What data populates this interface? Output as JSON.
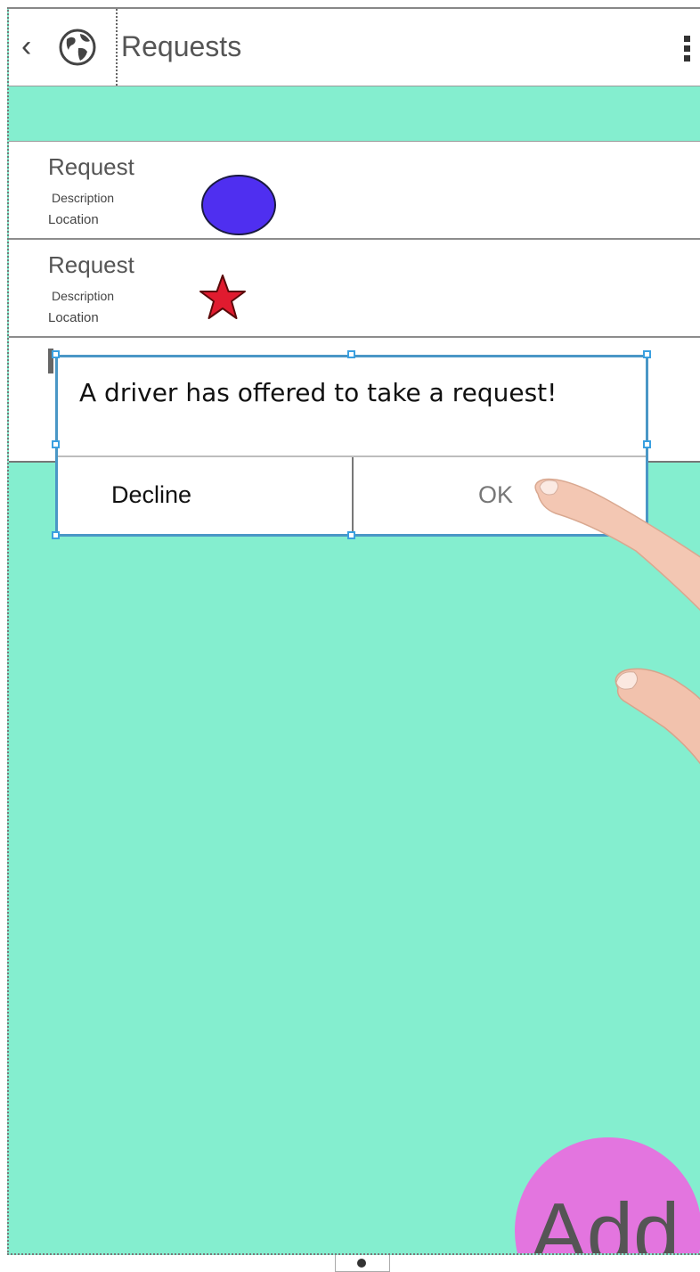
{
  "appbar": {
    "back_icon": "chevron-left-icon",
    "back_glyph": "‹",
    "globe_icon": "globe-icon",
    "title": "Requests",
    "menu_icon": "kebab-menu-icon"
  },
  "requests": [
    {
      "title": "Request",
      "description": "Description",
      "location": "Location",
      "marker": "circle",
      "marker_color": "#4f2ff0"
    },
    {
      "title": "Request",
      "description": "Description",
      "location": "Location",
      "marker": "star",
      "marker_color": "#e01b2f"
    }
  ],
  "dialog": {
    "message": "A driver has offered to take a request!",
    "decline_label": "Decline",
    "ok_label": "OK"
  },
  "fab": {
    "label": "Add",
    "color": "#e375df"
  },
  "colors": {
    "background": "#84eecf",
    "selection_handle": "#3aa0e0"
  }
}
